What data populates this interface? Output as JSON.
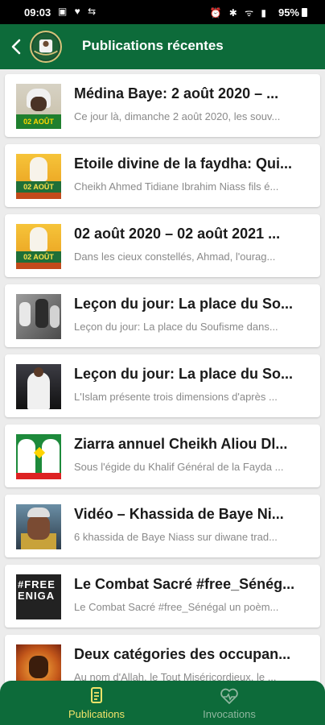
{
  "status_bar": {
    "time": "09:03",
    "battery": "95%"
  },
  "app_bar": {
    "title": "Publications récentes",
    "back_icon": "arrow-back-icon",
    "logo_icon": "app-logo-icon"
  },
  "colors": {
    "primary": "#0d6b3a",
    "active_nav": "#f1e36a",
    "inactive_nav": "#8fb79f"
  },
  "posts": [
    {
      "title": "Médina Baye: 2 août 2020 – ...",
      "excerpt": "Ce jour là, dimanche 2 août 2020, les souv...",
      "thumb": "portrait",
      "thumb_text": "02 AOÛT"
    },
    {
      "title": "Etoile divine de la faydha: Qui...",
      "excerpt": "Cheikh Ahmed Tidiane Ibrahim Niass fils é...",
      "thumb": "yellow",
      "thumb_text": "02 AOÛT"
    },
    {
      "title": "02 août 2020 – 02 août 2021 ...",
      "excerpt": "Dans les cieux constellés, Ahmad, l'ourag...",
      "thumb": "yellow",
      "thumb_text": "02 AOÛT"
    },
    {
      "title": "Leçon du jour: La place du So...",
      "excerpt": "Leçon du jour: La place du Soufisme dans...",
      "thumb": "gray",
      "thumb_text": ""
    },
    {
      "title": "Leçon du jour: La place du So...",
      "excerpt": "L'Islam présente trois dimensions d'après ...",
      "thumb": "dark",
      "thumb_text": ""
    },
    {
      "title": "Ziarra annuel Cheikh Aliou Dl...",
      "excerpt": "Sous l'égide du Khalif Général de la Fayda ...",
      "thumb": "ziarra",
      "thumb_text": ""
    },
    {
      "title": "Vidéo – Khassida de Baye Ni...",
      "excerpt": "6 khassida de Baye Niass sur diwane trad...",
      "thumb": "video",
      "thumb_text": ""
    },
    {
      "title": "Le Combat Sacré #free_Sénég...",
      "excerpt": "Le Combat Sacré #free_Sénégal un poèm...",
      "thumb": "free",
      "thumb_text": "#FREE ENIGA"
    },
    {
      "title": "Deux catégories des occupan...",
      "excerpt": "Au nom d'Allah, le Tout Miséricordieux, le ...",
      "thumb": "orange",
      "thumb_text": ""
    }
  ],
  "bottom_nav": [
    {
      "label": "Publications",
      "icon": "document-icon",
      "active": true
    },
    {
      "label": "Invocations",
      "icon": "heart-pulse-icon",
      "active": false
    }
  ]
}
